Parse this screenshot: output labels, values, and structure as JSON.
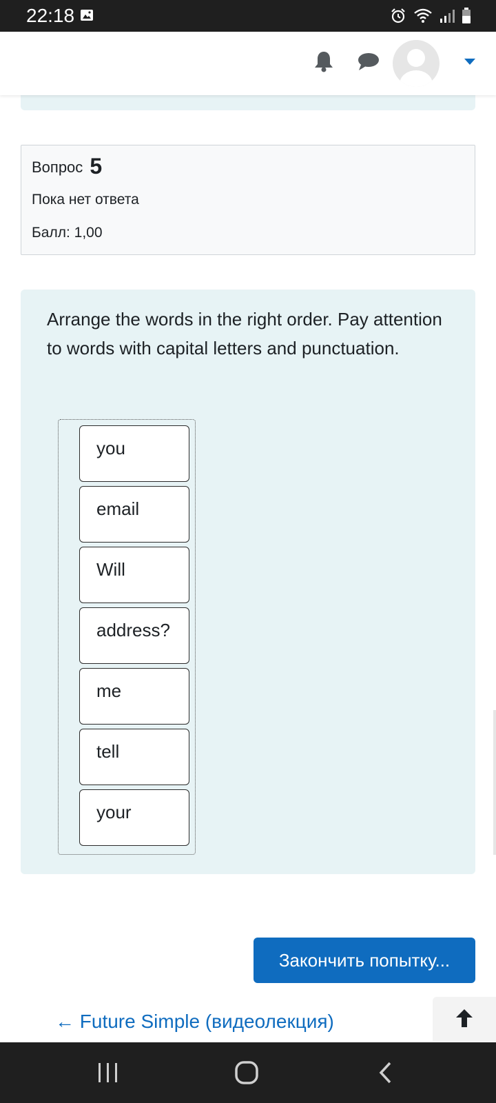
{
  "status_bar": {
    "time": "22:18",
    "icons": [
      "gallery-icon",
      "alarm-icon",
      "wifi-icon",
      "signal-icon",
      "battery-icon"
    ]
  },
  "navbar": {
    "icons": [
      "bell-icon",
      "chat-icon",
      "user-avatar",
      "caret-down-icon"
    ],
    "accent": "#0f6cbf"
  },
  "question": {
    "label": "Вопрос",
    "number": "5",
    "state": "Пока нет ответа",
    "mark": "Балл: 1,00",
    "text": "Arrange the words in the right order. Pay attention to words with capital letters and punctuation.",
    "words": [
      "you",
      "email",
      "Will",
      "address?",
      "me",
      "tell",
      "your"
    ]
  },
  "actions": {
    "finish_label": "Закончить попытку...",
    "prev_link": "← Future Simple (видеолекция)"
  },
  "colors": {
    "content_bg": "#e7f3f5",
    "info_bg": "#f8f9fa",
    "primary": "#0f6cbf"
  }
}
